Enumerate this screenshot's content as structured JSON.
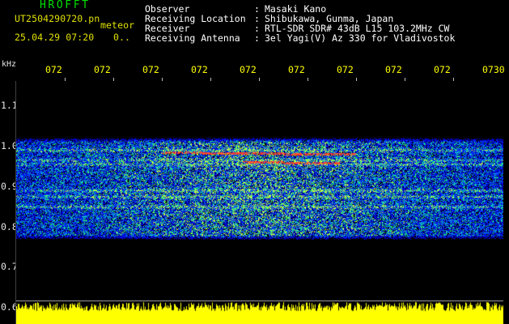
{
  "app": {
    "title": "HROFFT",
    "file_name": "UT2504290720.pn",
    "file_suffix": "meteor",
    "capture_time": "25.04.29 07:20",
    "capture_extra": "0.."
  },
  "info": {
    "rows": [
      {
        "label": "Observer",
        "value": "Masaki Kano"
      },
      {
        "label": "Receiving Location",
        "value": "Shibukawa, Gunma, Japan"
      },
      {
        "label": "Receiver",
        "value": "RTL-SDR SDR# 43dB L15 103.2MHz CW"
      },
      {
        "label": "Receiving Antenna",
        "value": "3el Yagi(V) Az 330 for Vladivostok"
      }
    ],
    "colon": ":"
  },
  "time_axis": {
    "ticks": [
      "072",
      "072",
      "072",
      "072",
      "072",
      "072",
      "072",
      "072",
      "072",
      "0730"
    ]
  },
  "freq_axis": {
    "unit": "kHz",
    "ticks": [
      "1.1",
      "1.0",
      "0.9",
      "0.8",
      "0.7",
      "0.6"
    ]
  },
  "spectrogram": {
    "bands_khz": [
      0.99,
      0.965,
      0.955,
      0.89,
      0.875,
      0.85
    ],
    "signal_region_khz": [
      0.78,
      1.01
    ],
    "meteor_echoes_khz": [
      0.985,
      0.96
    ]
  },
  "colors": {
    "title": "#00e000",
    "file_text": "#e0e000",
    "info_text": "#ffffff",
    "time_tick": "#ffff00",
    "freq_tick": "#e6e6e6",
    "signal_bar": "#ffff00",
    "background": "#000000"
  }
}
